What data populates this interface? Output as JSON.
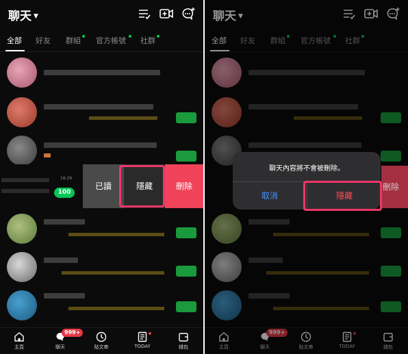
{
  "header": {
    "title": "聊天"
  },
  "tabs": [
    {
      "label": "全部",
      "active": true,
      "dot": false
    },
    {
      "label": "好友",
      "active": false,
      "dot": false
    },
    {
      "label": "群組",
      "active": false,
      "dot": true
    },
    {
      "label": "官方帳號",
      "active": false,
      "dot": true
    },
    {
      "label": "社群",
      "active": false,
      "dot": true
    }
  ],
  "swipe_row": {
    "time": "16:26",
    "unread": "100",
    "actions": {
      "read": "已讀",
      "hide": "隱藏",
      "delete": "刪除"
    }
  },
  "dialog": {
    "message": "聊天內容將不會被刪除。",
    "cancel": "取消",
    "confirm": "隱藏",
    "peek_delete": "刪除"
  },
  "bottom_nav": [
    {
      "label": "主頁",
      "icon": "home-icon"
    },
    {
      "label": "聊天",
      "icon": "chat-icon",
      "badge": "999+"
    },
    {
      "label": "貼文串",
      "icon": "clock-icon"
    },
    {
      "label": "TODAY",
      "icon": "news-icon",
      "dot": true
    },
    {
      "label": "錢包",
      "icon": "wallet-icon"
    }
  ],
  "colors": {
    "line_green": "#06c755",
    "highlight": "#f0366a",
    "delete_red": "#f0435a",
    "badge_red": "#e53946",
    "link_blue": "#4a90ff"
  }
}
